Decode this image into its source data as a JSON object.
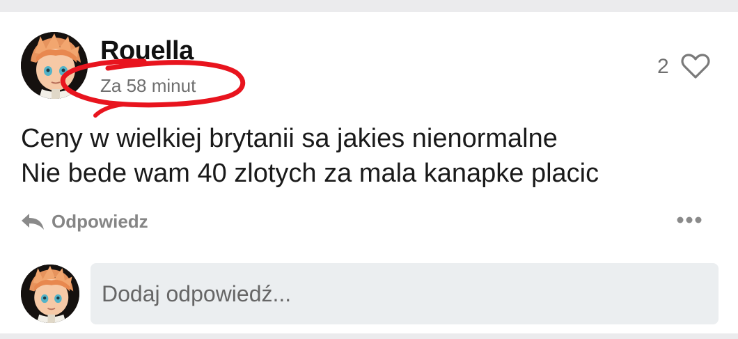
{
  "post": {
    "username": "Rouella",
    "timestamp": "Za 58 minut",
    "like_count": "2",
    "text_lines": [
      "Ceny w wielkiej brytanii sa jakies nienormalne",
      "Nie bede wam 40 zlotych za mala kanapke placic"
    ]
  },
  "actions": {
    "reply_label": "Odpowiedz",
    "reply_icon": "reply-arrow-icon",
    "more_icon": "more-dots-icon",
    "like_icon": "heart-icon"
  },
  "reply_box": {
    "placeholder": "Dodaj odpowiedź..."
  },
  "colors": {
    "annotation": "#e8141e",
    "icon_gray": "#8a8a8a",
    "input_bg": "#ebeef0"
  }
}
